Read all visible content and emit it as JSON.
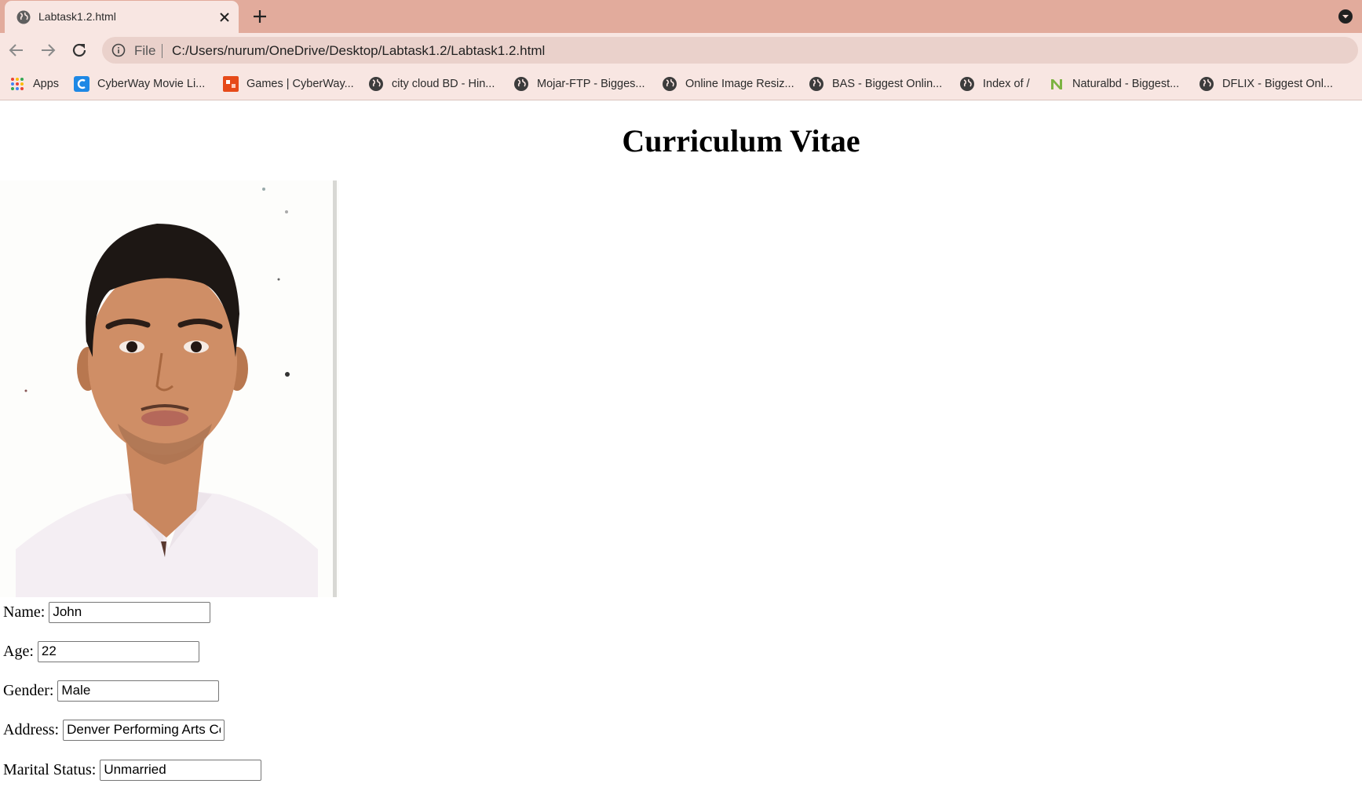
{
  "browser": {
    "tab_title": "Labtask1.2.html",
    "scheme_label": "File",
    "url": "C:/Users/nurum/OneDrive/Desktop/Labtask1.2/Labtask1.2.html",
    "bookmarks": [
      {
        "label": "Apps",
        "icon": "apps-grid-icon"
      },
      {
        "label": "CyberWay Movie Li...",
        "icon": "cyberway-c-icon"
      },
      {
        "label": "Games | CyberWay...",
        "icon": "games-icon"
      },
      {
        "label": "city cloud BD - Hin...",
        "icon": "globe-icon"
      },
      {
        "label": "Mojar-FTP - Bigges...",
        "icon": "globe-icon"
      },
      {
        "label": "Online Image Resiz...",
        "icon": "globe-icon"
      },
      {
        "label": "BAS - Biggest Onlin...",
        "icon": "globe-icon"
      },
      {
        "label": "Index of /",
        "icon": "globe-icon"
      },
      {
        "label": "Naturalbd - Biggest...",
        "icon": "naturalbd-n-icon"
      },
      {
        "label": "DFLIX - Biggest Onl...",
        "icon": "globe-icon"
      }
    ],
    "colors": {
      "tabstrip": "#e2ab9c",
      "toolbar": "#f8e6e2",
      "omnibox": "#ead1cb"
    }
  },
  "page": {
    "title": "Curriculum Vitae",
    "photo": "portrait-photo",
    "fields": [
      {
        "label": "Name:",
        "value": "John"
      },
      {
        "label": "Age:",
        "value": "22"
      },
      {
        "label": "Gender:",
        "value": "Male"
      },
      {
        "label": "Address:",
        "value": "Denver Performing Arts Cc"
      },
      {
        "label": "Marital Status:",
        "value": "Unmarried"
      }
    ]
  }
}
